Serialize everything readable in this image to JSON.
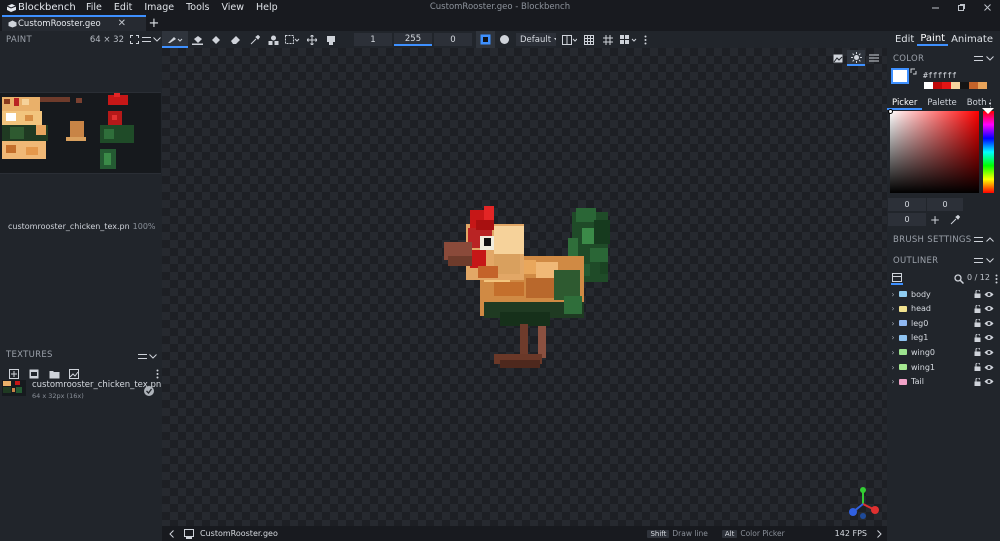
{
  "app": {
    "name": "Blockbench",
    "window_title": "CustomRooster.geo - Blockbench"
  },
  "menu": [
    "File",
    "Edit",
    "Image",
    "Tools",
    "View",
    "Help"
  ],
  "tabs": [
    {
      "label": "CustomRooster.geo"
    }
  ],
  "toolbar": {
    "brush_size": "1",
    "opacity": "255",
    "softness": "0",
    "blend_mode": "Default"
  },
  "modes": [
    "Edit",
    "Paint",
    "Animate"
  ],
  "active_mode": "Paint",
  "paint_panel": {
    "title": "PAINT",
    "texture_size": "64 × 32"
  },
  "texture_info": {
    "name": "customrooster_chicken_tex.pn",
    "zoom": "100%"
  },
  "textures_panel": {
    "title": "TEXTURES",
    "items": [
      {
        "name": "customrooster_chicken_tex.pn",
        "details": "64 x 32px (16x)"
      }
    ]
  },
  "color_panel": {
    "title": "COLOR",
    "hex": "#ffffff",
    "tabs": [
      "Picker",
      "Palette",
      "Both"
    ],
    "active_tab": "Picker",
    "palette": [
      "#ffffff",
      "#c00a0a",
      "#e31515",
      "#f6d4a0",
      "#141414",
      "#c4632a",
      "#e8a35a"
    ],
    "fields": [
      "0",
      "0",
      "0"
    ]
  },
  "brush_settings": {
    "title": "BRUSH SETTINGS"
  },
  "outliner": {
    "title": "OUTLINER",
    "count": "0 / 12",
    "items": [
      {
        "name": "body",
        "color": "#8fcdf2"
      },
      {
        "name": "head",
        "color": "#f2e28f"
      },
      {
        "name": "leg0",
        "color": "#8fb8f2"
      },
      {
        "name": "leg1",
        "color": "#8fc4f2"
      },
      {
        "name": "wing0",
        "color": "#9ce38f"
      },
      {
        "name": "wing1",
        "color": "#a5e891"
      },
      {
        "name": "Tail",
        "color": "#f2a3c8"
      }
    ]
  },
  "status": {
    "file": "CustomRooster.geo",
    "hint1_key": "Shift",
    "hint1_text": "Draw line",
    "hint2_key": "Alt",
    "hint2_text": "Color Picker",
    "fps": "142 FPS"
  }
}
